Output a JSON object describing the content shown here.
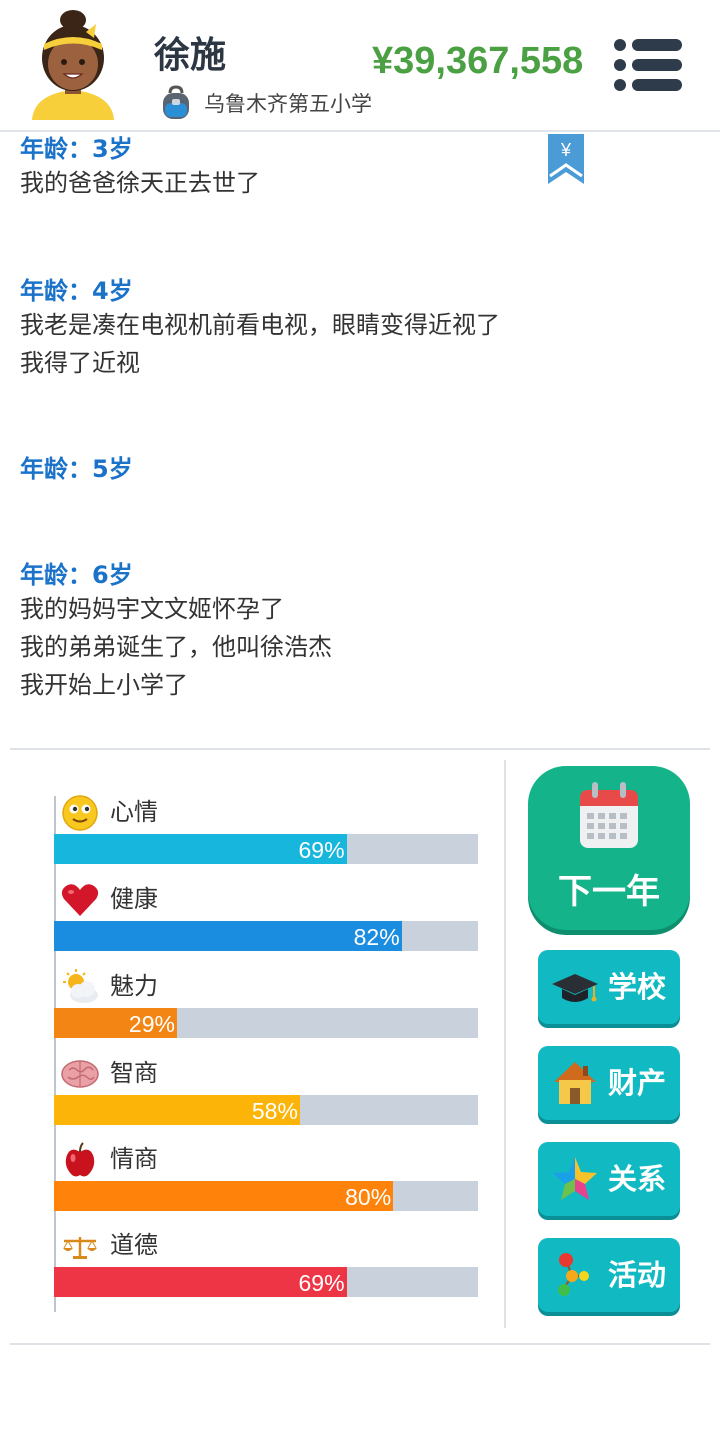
{
  "header": {
    "name": "徐施",
    "school": "乌鲁木齐第五小学",
    "money": "¥39,367,558"
  },
  "bookmark_symbol": "¥",
  "log": [
    {
      "age": "年龄：3岁",
      "lines": [
        "我的爸爸徐天正去世了"
      ]
    },
    {
      "age": "年龄：4岁",
      "lines": [
        "我老是凑在电视机前看电视，眼睛变得近视了",
        "我得了近视"
      ]
    },
    {
      "age": "年龄：5岁",
      "lines": []
    },
    {
      "age": "年龄：6岁",
      "lines": [
        "我的妈妈宇文文姬怀孕了",
        "我的弟弟诞生了，他叫徐浩杰",
        "我开始上小学了"
      ]
    }
  ],
  "stats": [
    {
      "label": "心情",
      "value": 69,
      "pct_text": "69%",
      "color": "#17b6dd",
      "icon": "smiley-icon"
    },
    {
      "label": "健康",
      "value": 82,
      "pct_text": "82%",
      "color": "#1b8de0",
      "icon": "heart-icon"
    },
    {
      "label": "魅力",
      "value": 29,
      "pct_text": "29%",
      "color": "#f28513",
      "icon": "sun-cloud-icon"
    },
    {
      "label": "智商",
      "value": 58,
      "pct_text": "58%",
      "color": "#fbb407",
      "icon": "brain-icon"
    },
    {
      "label": "情商",
      "value": 80,
      "pct_text": "80%",
      "color": "#ff820a",
      "icon": "apple-icon"
    },
    {
      "label": "道德",
      "value": 69,
      "pct_text": "69%",
      "color": "#ee3545",
      "icon": "scales-icon"
    }
  ],
  "buttons": {
    "next_year": "下一年",
    "school": "学校",
    "assets": "财产",
    "relations": "关系",
    "activities": "活动"
  },
  "colors": {
    "money": "#4aa043",
    "age_label": "#1a72c9",
    "next_button": "#14b38a",
    "side_button": "#11b9c2"
  }
}
